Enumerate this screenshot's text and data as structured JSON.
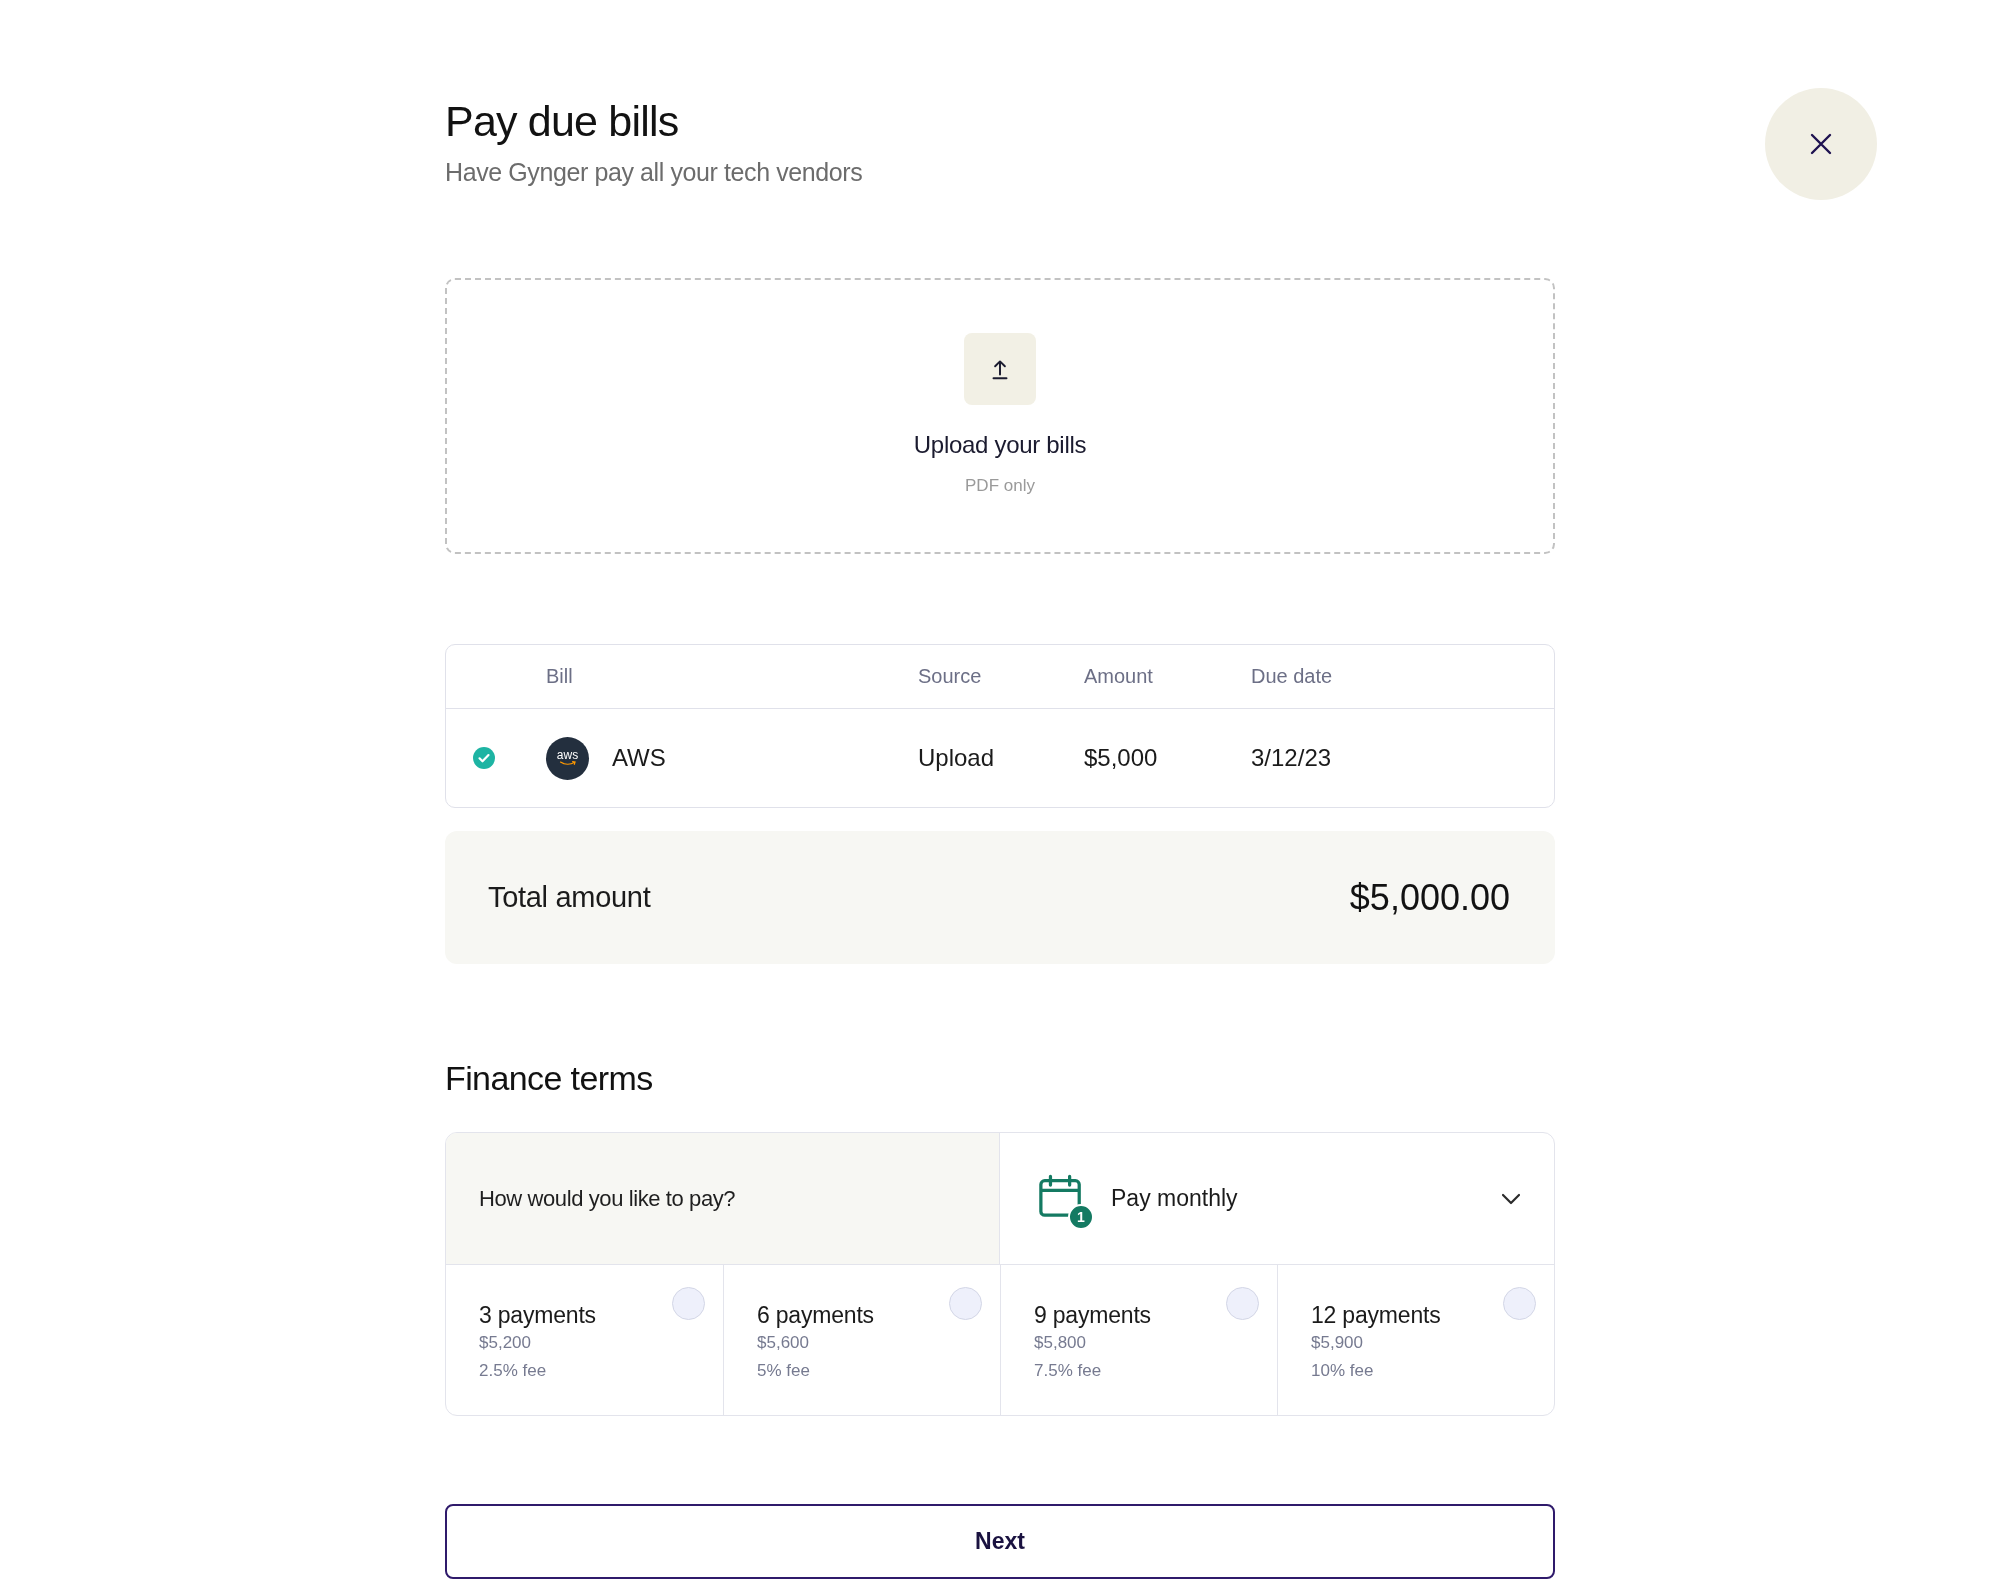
{
  "page": {
    "title": "Pay due bills",
    "subtitle": "Have Gynger pay all your tech vendors"
  },
  "upload": {
    "label": "Upload your bills",
    "hint": "PDF only"
  },
  "bills_table": {
    "columns": [
      "Bill",
      "Source",
      "Amount",
      "Due date"
    ],
    "rows": [
      {
        "checked": true,
        "logo_text": "aws",
        "bill": "AWS",
        "source": "Upload",
        "amount": "$5,000",
        "due_date": "3/12/23"
      }
    ]
  },
  "total": {
    "label": "Total amount",
    "value": "$5,000.00"
  },
  "finance_terms": {
    "heading": "Finance terms",
    "question": "How would you like to pay?",
    "pay_method": {
      "label": "Pay monthly",
      "badge": "1"
    },
    "options": [
      {
        "title": "3 payments",
        "price": "$5,200",
        "fee": "2.5% fee",
        "selected": false
      },
      {
        "title": "6 payments",
        "price": "$5,600",
        "fee": "5% fee",
        "selected": false
      },
      {
        "title": "9 payments",
        "price": "$5,800",
        "fee": "7.5% fee",
        "selected": false
      },
      {
        "title": "12 payments",
        "price": "$5,900",
        "fee": "10% fee",
        "selected": false
      }
    ]
  },
  "next_button": {
    "label": "Next"
  }
}
